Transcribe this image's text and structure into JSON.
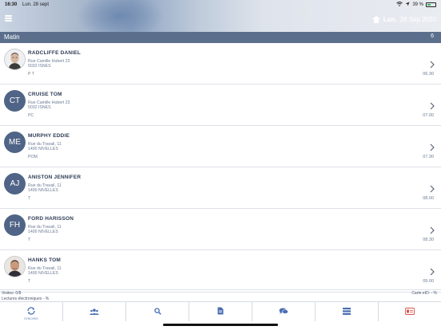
{
  "status_bar": {
    "time": "16:30",
    "date": "Lun. 28 sept",
    "battery": "39 %"
  },
  "header": {
    "day": "Lun.",
    "date": "28 Sep 2020"
  },
  "section": {
    "title": "Matin",
    "count": "6"
  },
  "visits": [
    {
      "name": "RADCLIFFE DANIEL",
      "initials": "",
      "avatar": "photo",
      "street": "Rue Camille Hubert 23",
      "city": "5032 ISNES",
      "code": "P T",
      "time": "06.30"
    },
    {
      "name": "CRUISE TOM",
      "initials": "CT",
      "avatar": "initials",
      "street": "Rue Camille Hubert 23",
      "city": "5032 ISNES",
      "code": "PC",
      "time": "07.00"
    },
    {
      "name": "MURPHY EDDIE",
      "initials": "ME",
      "avatar": "initials",
      "street": "Rue du Travail, 11",
      "city": "1400 NIVELLES",
      "code": "POM",
      "time": "07.30"
    },
    {
      "name": "ANISTON JENNIFER",
      "initials": "AJ",
      "avatar": "initials",
      "street": "Rue du Travail, 11",
      "city": "1400 NIVELLES",
      "code": "T",
      "time": "08.00"
    },
    {
      "name": "FORD HARISSON",
      "initials": "FH",
      "avatar": "initials",
      "street": "Rue du Travail, 11",
      "city": "1400 NIVELLES",
      "code": "T",
      "time": "08.30"
    },
    {
      "name": "HANKS TOM",
      "initials": "",
      "avatar": "photo",
      "street": "Rue du Travail, 11",
      "city": "1400 NIVELLES",
      "code": "T",
      "time": "09.00"
    }
  ],
  "footer": {
    "visits": "Visites: 0/8",
    "reads": "Lectures électroniques - %",
    "card": "Carte eID: - %"
  },
  "tabs": [
    {
      "icon": "sync-icon",
      "label": "SYNCHRO",
      "color": "#4a6db3"
    },
    {
      "icon": "users-icon",
      "label": "",
      "color": "#4a6db3"
    },
    {
      "icon": "search-icon",
      "label": "",
      "color": "#4a6db3"
    },
    {
      "icon": "document-icon",
      "label": "",
      "color": "#4a6db3"
    },
    {
      "icon": "chat-icon",
      "label": "",
      "color": "#4a6db3"
    },
    {
      "icon": "list-icon",
      "label": "",
      "color": "#4a6db3"
    },
    {
      "icon": "id-card-icon",
      "label": "",
      "color": "#d9534f"
    }
  ],
  "colors": {
    "header_bar": "#5b6f8c",
    "avatar": "#4f6486",
    "name": "#2d3b55"
  }
}
